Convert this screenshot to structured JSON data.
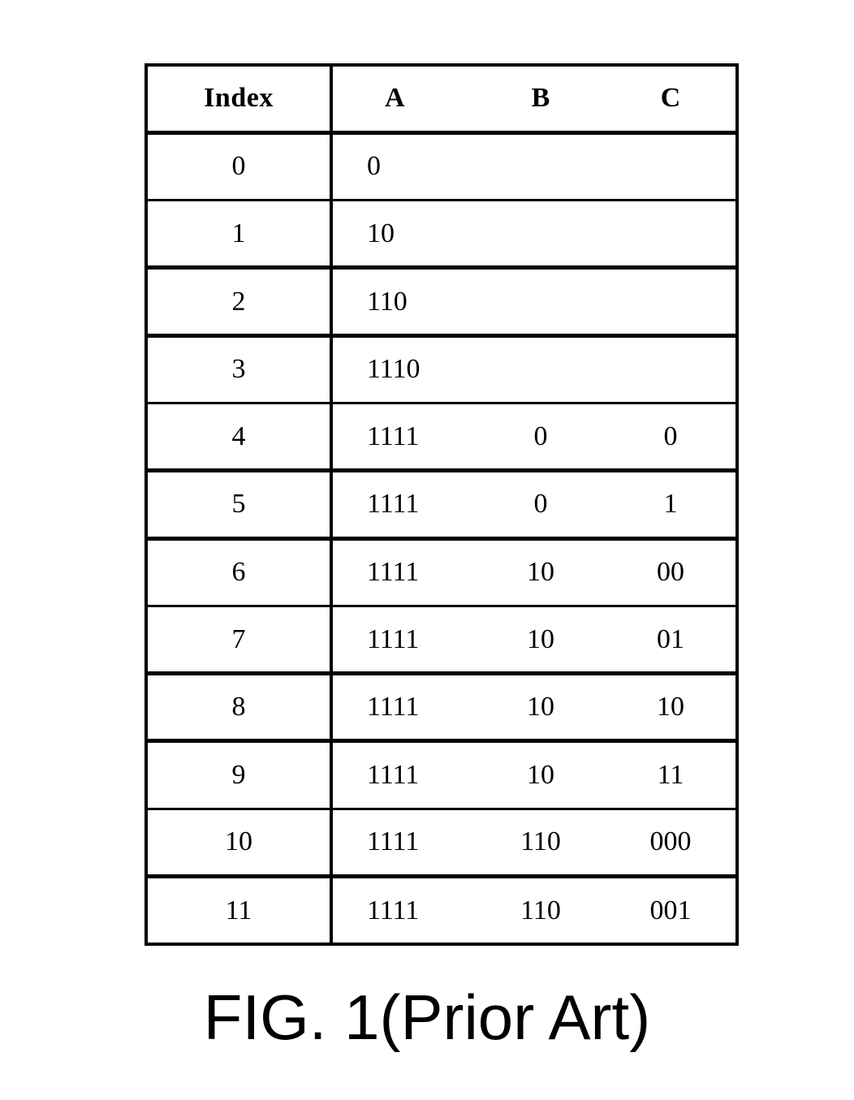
{
  "figure": {
    "caption": "FIG. 1(Prior Art)",
    "background_color": "#ffffff",
    "line_color": "#000000"
  },
  "table": {
    "columns": [
      {
        "key": "index",
        "label": "Index"
      },
      {
        "key": "a",
        "label": "A"
      },
      {
        "key": "b",
        "label": "B"
      },
      {
        "key": "c",
        "label": "C"
      }
    ],
    "rows": [
      {
        "index": "0",
        "a": "0",
        "b": "",
        "c": ""
      },
      {
        "index": "1",
        "a": "10",
        "b": "",
        "c": ""
      },
      {
        "index": "2",
        "a": "110",
        "b": "",
        "c": ""
      },
      {
        "index": "3",
        "a": "1110",
        "b": "",
        "c": ""
      },
      {
        "index": "4",
        "a": "1111",
        "b": "0",
        "c": "0"
      },
      {
        "index": "5",
        "a": "1111",
        "b": "0",
        "c": "1"
      },
      {
        "index": "6",
        "a": "1111",
        "b": "10",
        "c": "00"
      },
      {
        "index": "7",
        "a": "1111",
        "b": "10",
        "c": "01"
      },
      {
        "index": "8",
        "a": "1111",
        "b": "10",
        "c": "10"
      },
      {
        "index": "9",
        "a": "1111",
        "b": "10",
        "c": "11"
      },
      {
        "index": "10",
        "a": "1111",
        "b": "110",
        "c": "000"
      },
      {
        "index": "11",
        "a": "1111",
        "b": "110",
        "c": "001"
      }
    ]
  },
  "chart_data": {
    "type": "table",
    "title": "FIG. 1(Prior Art)",
    "columns": [
      "Index",
      "A",
      "B",
      "C"
    ],
    "rows": [
      [
        "0",
        "0",
        "",
        ""
      ],
      [
        "1",
        "10",
        "",
        ""
      ],
      [
        "2",
        "110",
        "",
        ""
      ],
      [
        "3",
        "1110",
        "",
        ""
      ],
      [
        "4",
        "1111",
        "0",
        "0"
      ],
      [
        "5",
        "1111",
        "0",
        "1"
      ],
      [
        "6",
        "1111",
        "10",
        "00"
      ],
      [
        "7",
        "1111",
        "10",
        "01"
      ],
      [
        "8",
        "1111",
        "10",
        "10"
      ],
      [
        "9",
        "1111",
        "10",
        "11"
      ],
      [
        "10",
        "1111",
        "110",
        "000"
      ],
      [
        "11",
        "1111",
        "110",
        "001"
      ]
    ]
  }
}
